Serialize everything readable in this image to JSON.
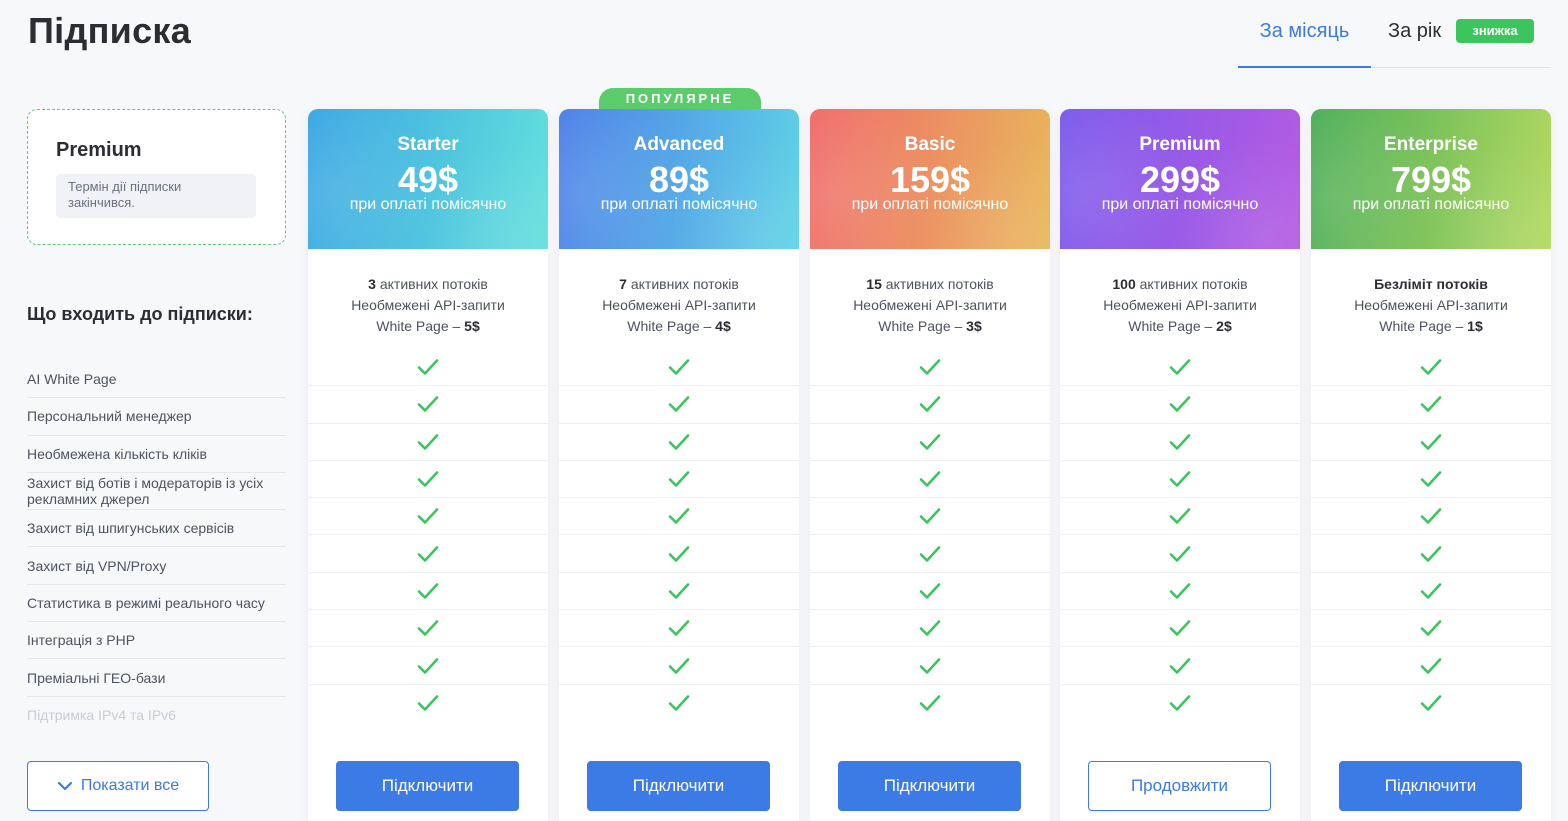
{
  "header": {
    "title": "Підписка",
    "tab_month": "За місяць",
    "tab_year": "За рік",
    "discount_badge": "знижка"
  },
  "current_plan": {
    "name": "Premium",
    "status": "Термін дії підписки закінчився."
  },
  "features": {
    "heading": "Що входить до підписки:",
    "items": [
      "AI White Page",
      "Персональний менеджер",
      "Необмежена кількість кліків",
      "Захист від ботів і модераторів із усіх рекламних джерел",
      "Захист від шпигунських сервісів",
      "Захист від VPN/Proxy",
      "Статистика в режимі реального часу",
      "Інтеграція з PHP",
      "Преміальні ГЕО-бази",
      "Підтримка IPv4 та IPv6"
    ],
    "show_all_label": "Показати все"
  },
  "colors": {
    "accent": "#3c7ae6",
    "check": "#3cc55c",
    "popular": "#5ccb6c"
  },
  "plans": [
    {
      "name": "Starter",
      "price": "49$",
      "period": "при оплаті помісячно",
      "streams_count": "3",
      "streams_label": " активних потоків",
      "api": "Необмежені API-запити",
      "white_page_label": "White Page – ",
      "white_page_price": "5$",
      "button": "Підключити",
      "button_style": "filled",
      "gradient": [
        "#3aa6e3",
        "#63e0dc"
      ]
    },
    {
      "name": "Advanced",
      "price": "89$",
      "period": "при оплаті помісячно",
      "streams_count": "7",
      "streams_label": " активних потоків",
      "api": "Необмежені API-запити",
      "white_page_label": "White Page – ",
      "white_page_price": "4$",
      "button": "Підключити",
      "button_style": "filled",
      "badge": "ПОПУЛЯРНЕ",
      "gradient": [
        "#4c7fe8",
        "#5fd3e6"
      ]
    },
    {
      "name": "Basic",
      "price": "159$",
      "period": "при оплаті помісячно",
      "streams_count": "15",
      "streams_label": " активних потоків",
      "api": "Необмежені API-запити",
      "white_page_label": "White Page – ",
      "white_page_price": "3$",
      "button": "Підключити",
      "button_style": "filled",
      "gradient": [
        "#f06a6a",
        "#e8b85a"
      ]
    },
    {
      "name": "Premium",
      "price": "299$",
      "period": "при оплаті помісячно",
      "streams_count": "100",
      "streams_label": " активних потоків",
      "api": "Необмежені API-запити",
      "white_page_label": "White Page – ",
      "white_page_price": "2$",
      "button": "Продовжити",
      "button_style": "outline",
      "gradient": [
        "#7b59ec",
        "#b55be2"
      ]
    },
    {
      "name": "Enterprise",
      "price": "799$",
      "period": "при оплаті помісячно",
      "streams_count": "Безліміт потоків",
      "streams_label": "",
      "api": "Необмежені API-запити",
      "white_page_label": "White Page – ",
      "white_page_price": "1$",
      "button": "Підключити",
      "button_style": "filled",
      "gradient": [
        "#4cae58",
        "#b3d960"
      ]
    }
  ]
}
